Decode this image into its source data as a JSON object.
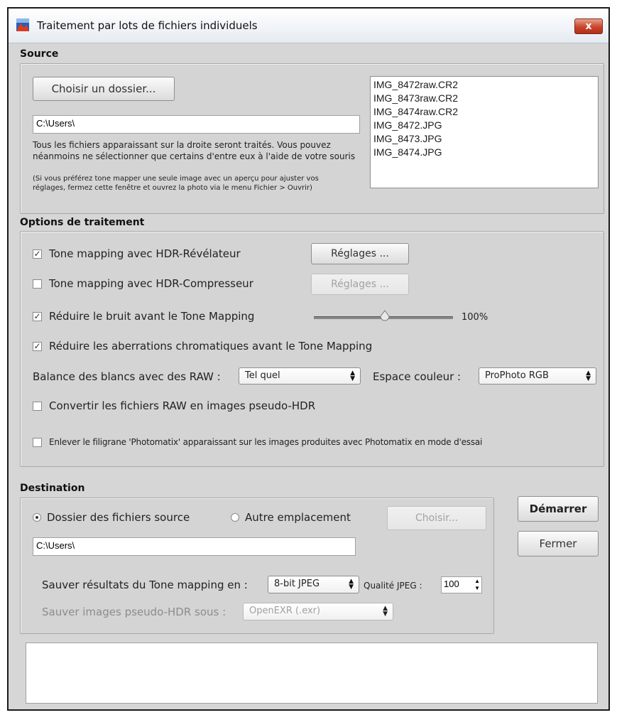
{
  "window": {
    "title": "Traitement par lots de fichiers individuels",
    "close_label": "x"
  },
  "source": {
    "heading": "Source",
    "choose_folder_label": "Choisir un dossier...",
    "path_value": "C:\\Users\\",
    "info_text": "Tous les fichiers apparaissant sur la droite seront traités. Vous pouvez néanmoins ne sélectionner que certains d'entre eux à l'aide de votre souris",
    "note_text": "(Si vous préférez tone mapper une seule image avec un aperçu pour ajuster vos réglages, fermez cette fenêtre et ouvrez la photo via le menu Fichier > Ouvrir)",
    "files": [
      "IMG_8472raw.CR2",
      "IMG_8473raw.CR2",
      "IMG_8474raw.CR2",
      "IMG_8472.JPG",
      "IMG_8473.JPG",
      "IMG_8474.JPG"
    ]
  },
  "options": {
    "heading": "Options de traitement",
    "tm_revelateur": {
      "label": "Tone mapping avec HDR-Révélateur",
      "checked": true,
      "settings_label": "Réglages ..."
    },
    "tm_compresseur": {
      "label": "Tone mapping avec HDR-Compresseur",
      "checked": false,
      "settings_label": "Réglages ..."
    },
    "noise": {
      "label": "Réduire le bruit avant le Tone Mapping",
      "checked": true,
      "value_label": "100%"
    },
    "aberrations": {
      "label": "Réduire les aberrations chromatiques avant le Tone Mapping",
      "checked": true
    },
    "wb_label": "Balance des blancs avec des RAW :",
    "wb_value": "Tel quel",
    "colorspace_label": "Espace couleur :",
    "colorspace_value": "ProPhoto RGB",
    "pseudo_hdr": {
      "label": "Convertir les fichiers RAW en images pseudo-HDR",
      "checked": false
    },
    "watermark": {
      "label": "Enlever le filigrane 'Photomatix' apparaissant sur les images produites avec Photomatix en mode d'essai",
      "checked": false
    }
  },
  "destination": {
    "heading": "Destination",
    "radio_source_label": "Dossier des fichiers source",
    "radio_other_label": "Autre emplacement",
    "choose_label": "Choisir...",
    "path_value": "C:\\Users\\",
    "save_tm_label": "Sauver résultats du Tone mapping en :",
    "save_tm_value": "8-bit JPEG",
    "quality_label": "Qualité JPEG :",
    "quality_value": "100",
    "save_pseudo_label": "Sauver images pseudo-HDR sous :",
    "save_pseudo_value": "OpenEXR (.exr)"
  },
  "actions": {
    "start_label": "Démarrer",
    "close_label": "Fermer"
  },
  "log": {
    "text": ""
  }
}
